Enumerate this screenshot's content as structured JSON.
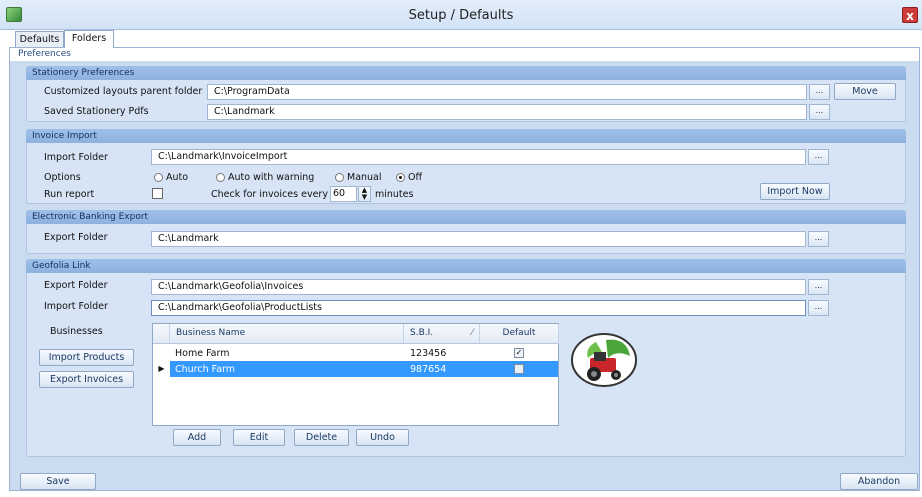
{
  "window": {
    "title": "Setup / Defaults",
    "close_label": "x"
  },
  "tabs": [
    {
      "label": "Defaults"
    },
    {
      "label": "Folders"
    }
  ],
  "preferences_label": "Preferences",
  "stationery": {
    "header": "Stationery Preferences",
    "customized_label": "Customized layouts parent folder",
    "customized_value": "C:\\ProgramData",
    "saved_label": "Saved Stationery Pdfs",
    "saved_value": "C:\\Landmark",
    "move_label": "Move"
  },
  "invoice_import": {
    "header": "Invoice Import",
    "folder_label": "Import Folder",
    "folder_value": "C:\\Landmark\\InvoiceImport",
    "options_label": "Options",
    "options": [
      "Auto",
      "Auto with warning",
      "Manual",
      "Off"
    ],
    "selected_option": "Off",
    "run_report_label": "Run report",
    "check_label": "Check for invoices every",
    "check_value": "60",
    "minutes_label": "minutes",
    "import_now_label": "Import Now"
  },
  "banking": {
    "header": "Electronic Banking Export",
    "folder_label": "Export Folder",
    "folder_value": "C:\\Landmark"
  },
  "geofolia": {
    "header": "Geofolia Link",
    "export_label": "Export Folder",
    "export_value": "C:\\Landmark\\Geofolia\\Invoices",
    "import_label": "Import Folder",
    "import_value": "C:\\Landmark\\Geofolia\\ProductLists",
    "businesses_label": "Businesses",
    "import_products_label": "Import Products",
    "export_invoices_label": "Export Invoices",
    "columns": [
      "Business Name",
      "S.B.I.",
      "Default"
    ],
    "rows": [
      {
        "name": "Home Farm",
        "sbi": "123456",
        "default": true
      },
      {
        "name": "Church Farm",
        "sbi": "987654",
        "default": false
      }
    ],
    "add_label": "Add",
    "edit_label": "Edit",
    "delete_label": "Delete",
    "undo_label": "Undo"
  },
  "footer": {
    "save_label": "Save",
    "abandon_label": "Abandon"
  },
  "dots_label": "...",
  "colors": {
    "accent": "#3399ff",
    "header": "#9fc0e8",
    "panel": "#d6e4f6"
  }
}
